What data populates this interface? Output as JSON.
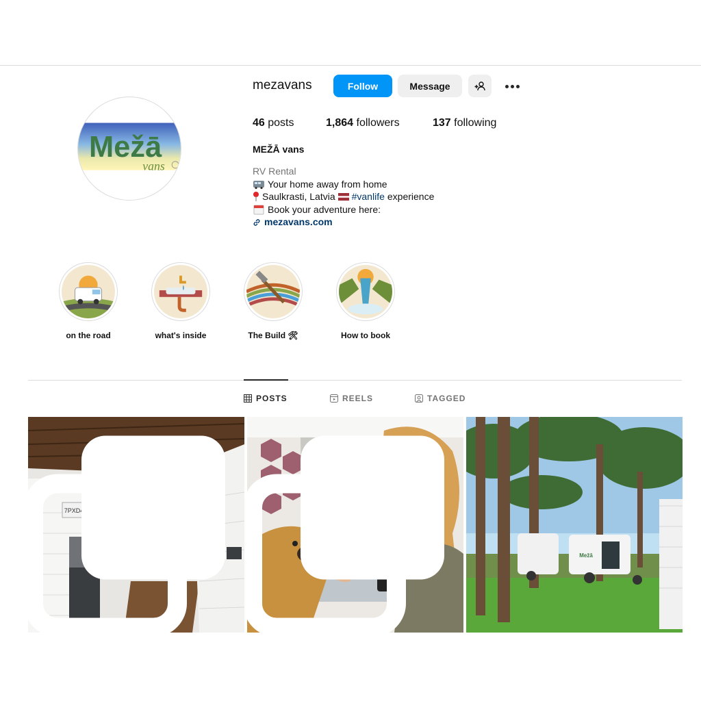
{
  "profile": {
    "username": "mezavans",
    "avatar_text": "Mežā",
    "avatar_subtext": "vans",
    "display_name": "MEŽĀ vans",
    "category": "RV Rental",
    "bio_lines": [
      "Your home away from home",
      "Saulkrasti, Latvia",
      "#vanlife",
      "experience",
      "Book your adventure here:"
    ],
    "link": "mezavans.com"
  },
  "actions": {
    "follow": "Follow",
    "message": "Message"
  },
  "stats": {
    "posts_count": "46",
    "posts_label": "posts",
    "followers_count": "1,864",
    "followers_label": "followers",
    "following_count": "137",
    "following_label": "following"
  },
  "highlights": [
    {
      "label": "on the road"
    },
    {
      "label": "what's inside"
    },
    {
      "label": "The Build 🛠"
    },
    {
      "label": "How to book"
    }
  ],
  "tabs": {
    "posts": "POSTS",
    "reels": "REELS",
    "tagged": "TAGGED"
  },
  "posts": [
    {
      "license_plate": "7PXD435",
      "multiple": true
    },
    {
      "multiple": true
    },
    {
      "van_logo": "Mežā",
      "multiple": false
    }
  ],
  "colors": {
    "follow_button": "#0095f6",
    "secondary_button": "#efefef",
    "link": "#00376b",
    "muted": "#737373"
  }
}
